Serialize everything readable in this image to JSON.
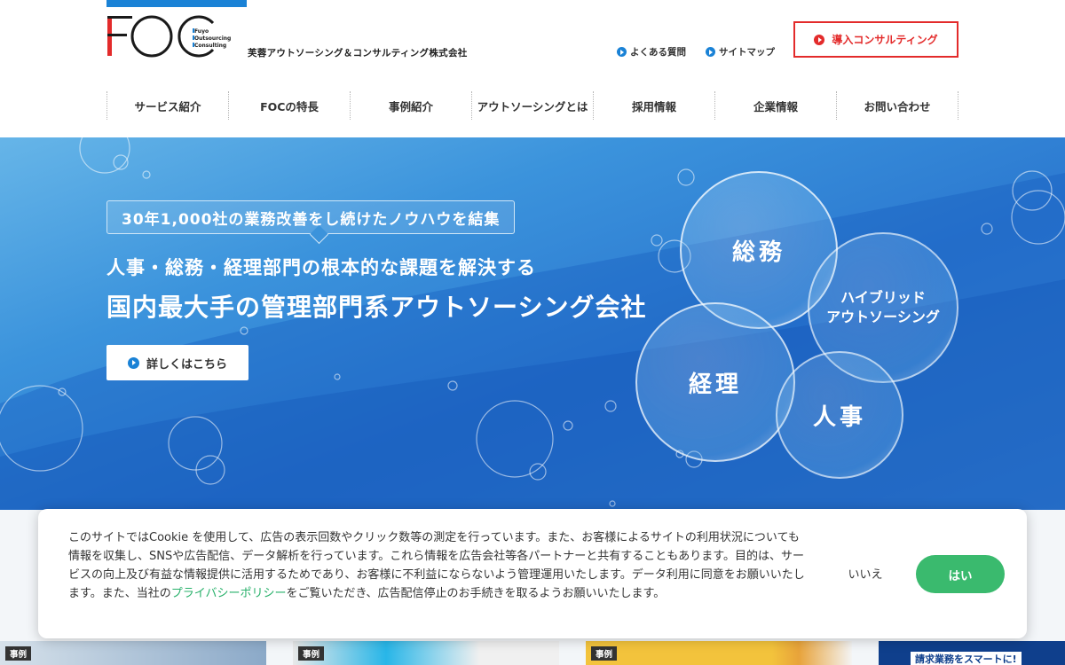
{
  "header": {
    "logo_text": "FOC",
    "logo_sub": [
      "Fuyo",
      "Outsourcing",
      "Consulting"
    ],
    "company_name": "芙蓉アウトソーシング＆コンサルティング株式会社",
    "util_links": [
      {
        "label": "よくある質問",
        "icon": "circle-arrow-icon"
      },
      {
        "label": "サイトマップ",
        "icon": "circle-arrow-icon"
      }
    ],
    "cta_label": "導入コンサルティング",
    "brand_color": "#1a82d6",
    "cta_color": "#e32b2b"
  },
  "nav": {
    "items": [
      "サービス紹介",
      "FOCの特長",
      "事例紹介",
      "アウトソーシングとは",
      "採用情報",
      "企業情報",
      "お問い合わせ"
    ]
  },
  "hero": {
    "bubble_label": "30年1,000社の業務改善をし続けたノウハウを結集",
    "subtitle": "人事・総務・経理部門の根本的な課題を解決する",
    "title": "国内最大手の管理部門系アウトソーシング会社",
    "button_label": "詳しくはこちら",
    "circles": {
      "soumu": "総務",
      "hybrid_line1": "ハイブリッド",
      "hybrid_line2": "アウトソーシング",
      "keiri": "経理",
      "jinji": "人事"
    }
  },
  "cards": [
    {
      "tag": "事例"
    },
    {
      "tag": "事例"
    },
    {
      "tag": "事例"
    },
    {
      "text": "請求業務をスマートに!"
    }
  ],
  "cookie": {
    "text_before_link": "このサイトではCookie を使用して、広告の表示回数やクリック数等の測定を行っています。また、お客様によるサイトの利用状況についても情報を収集し、SNSや広告配信、データ解析を行っています。これら情報を広告会社等各パートナーと共有することもあります。目的は、サービスの向上及び有益な情報提供に活用するためであり、お客様に不利益にならないよう管理運用いたします。データ利用に同意をお願いいたします。また、当社の",
    "link_text": "プライバシーポリシー",
    "text_after_link": "をご覧いただき、広告配信停止のお手続きを取るようお願いいたします。",
    "no_label": "いいえ",
    "yes_label": "はい",
    "accept_color": "#3aba6e",
    "link_color": "#27b06a"
  }
}
